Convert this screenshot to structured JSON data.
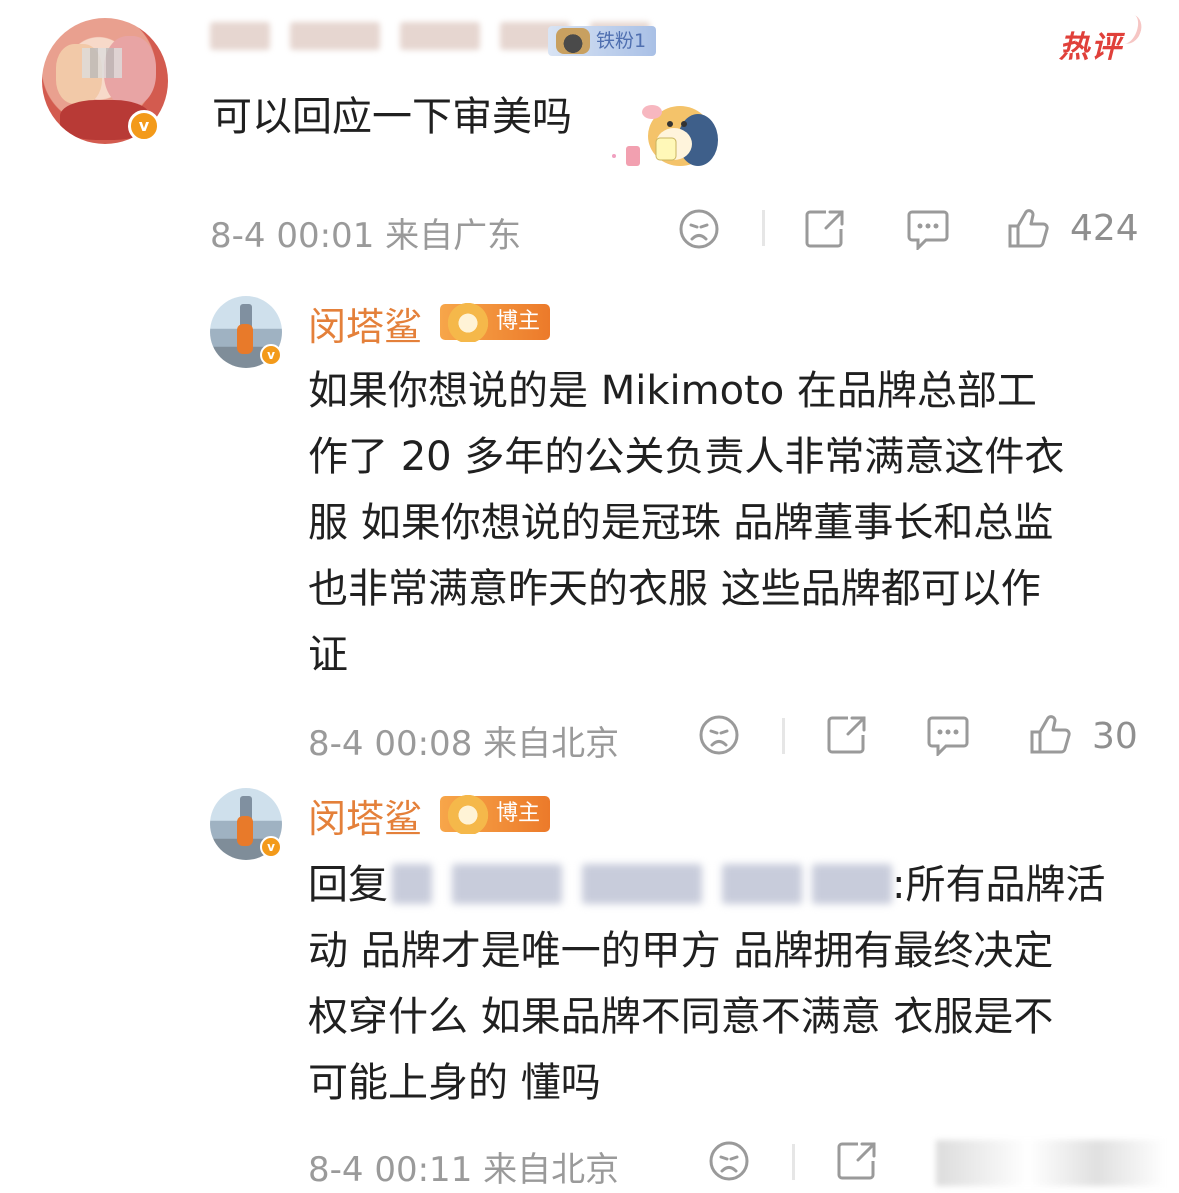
{
  "top_comment": {
    "fan_badge": "铁粉1",
    "hot_tag": "热评",
    "text": "可以回应一下审美吗",
    "meta": "8-4 00:01 来自广东",
    "likes": "424",
    "verified_mark": "v"
  },
  "replies": [
    {
      "user": "闵塔鲨",
      "badge": "博主",
      "text_lines": [
        "如果你想说的是 Mikimoto 在品牌总部工",
        "作了 20 多年的公关负责人非常满意这件衣",
        "服 如果你想说的是冠珠 品牌董事长和总监",
        "也非常满意昨天的衣服 这些品牌都可以作",
        "证"
      ],
      "meta": "8-4 00:08 来自北京",
      "likes": "30",
      "verified_mark": "v"
    },
    {
      "user": "闵塔鲨",
      "badge": "博主",
      "reply_prefix": "回复",
      "reply_suffix": ":所有品牌活",
      "text_lines": [
        "动 品牌才是唯一的甲方 品牌拥有最终决定",
        "权穿什么 如果品牌不同意不满意 衣服是不",
        "可能上身的 懂吗"
      ],
      "meta": "8-4 00:11 来自北京",
      "verified_mark": "v"
    }
  ],
  "icons": [
    "sad-face-icon",
    "share-icon",
    "comment-icon",
    "thumbs-up-icon"
  ],
  "colors": {
    "username": "#e4803a",
    "hot": "#e0403a",
    "meta": "#9a9a9a",
    "verified": "#f39a1a"
  }
}
